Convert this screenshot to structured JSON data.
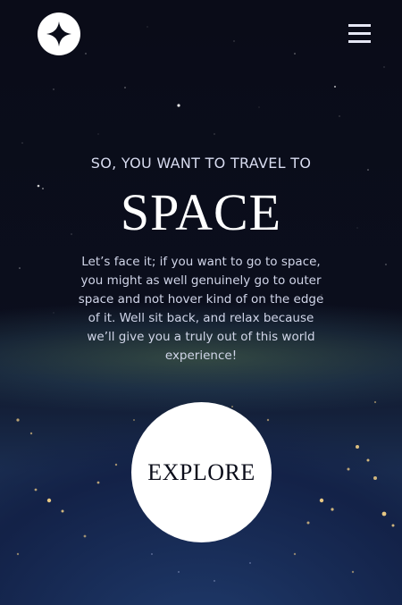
{
  "header": {
    "logo_icon": "four-point-star-icon",
    "menu_icon": "hamburger-menu-icon"
  },
  "hero": {
    "eyebrow": "SO, YOU WANT TO TRAVEL TO",
    "title": "SPACE",
    "description": "Let’s face it; if you want to go to space, you might as well genuinely go to outer space and not hover kind of on the edge of it. Well sit back, and relax because we’ll give you a truly out of this world experience!",
    "cta_label": "EXPLORE"
  },
  "colors": {
    "background": "#0b0d1a",
    "accent": "#ffffff",
    "text_muted": "#d0d5e8"
  }
}
